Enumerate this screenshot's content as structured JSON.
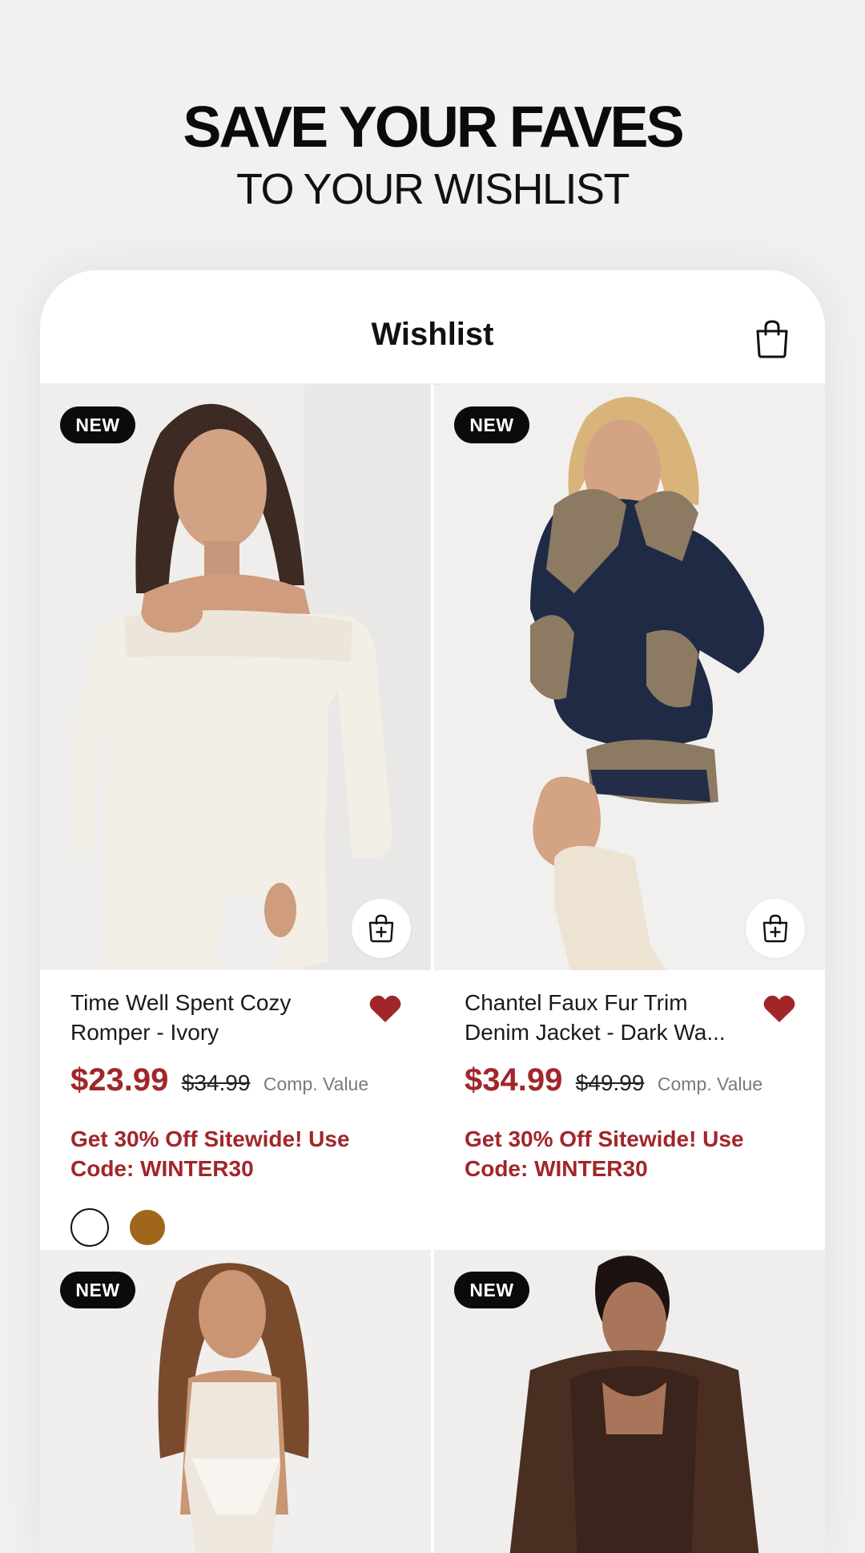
{
  "promo": {
    "title": "SAVE YOUR FAVES",
    "subtitle": "TO YOUR WISHLIST"
  },
  "header": {
    "title": "Wishlist",
    "bag_icon": "shopping-bag-icon"
  },
  "colors": {
    "brand_red": "#a1262a",
    "badge_black": "#0b0b0b",
    "background": "#f2f1ef"
  },
  "products": [
    {
      "badge": "NEW",
      "name": "Time Well Spent Cozy Romper - Ivory",
      "sale_price": "$23.99",
      "original_price": "$34.99",
      "comp_label": "Comp. Value",
      "promo": "Get 30% Off Sitewide! Use Code: WINTER30",
      "swatches": [
        "#ffffff",
        "#a0661c"
      ],
      "wishlisted": true
    },
    {
      "badge": "NEW",
      "name": "Chantel Faux Fur Trim Denim Jacket - Dark Wa...",
      "sale_price": "$34.99",
      "original_price": "$49.99",
      "comp_label": "Comp. Value",
      "promo": "Get 30% Off Sitewide! Use Code: WINTER30",
      "swatches": [],
      "wishlisted": true
    },
    {
      "badge": "NEW"
    },
    {
      "badge": "NEW"
    }
  ]
}
